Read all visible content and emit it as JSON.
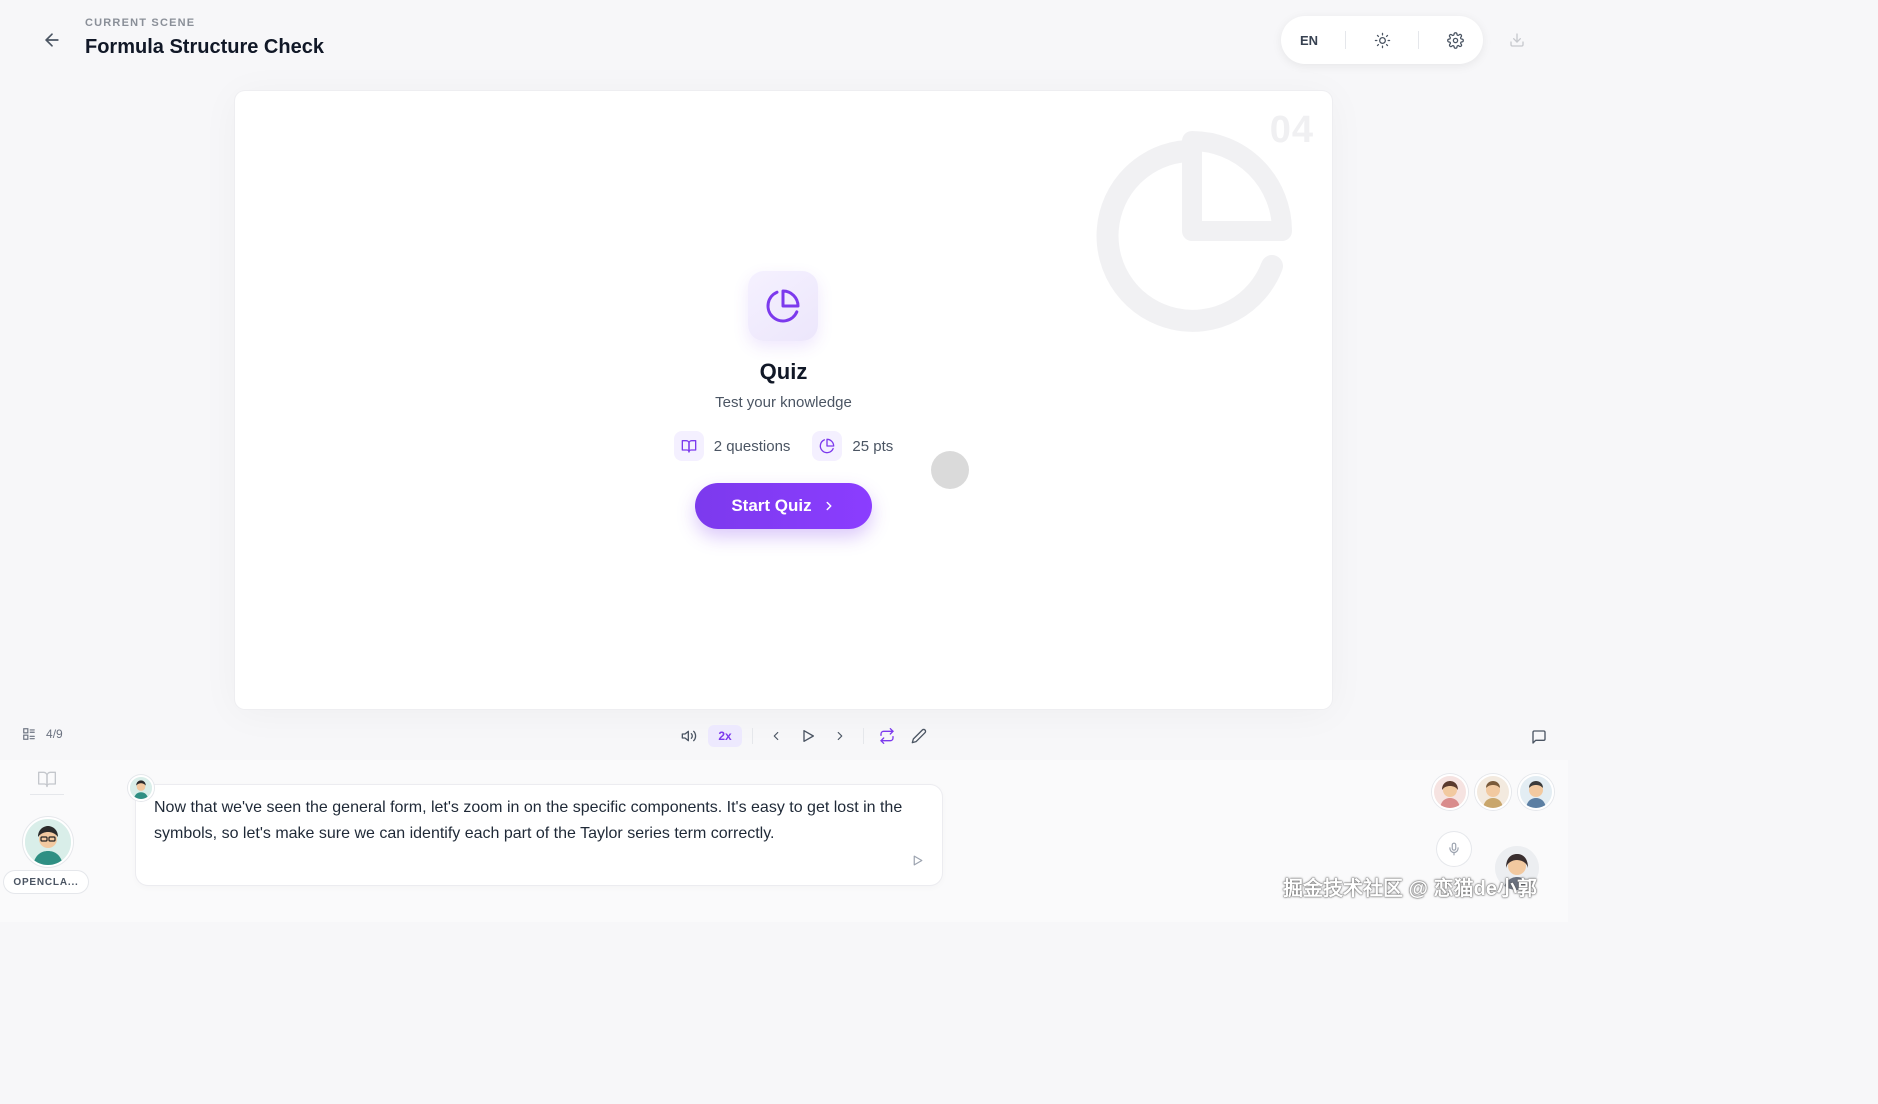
{
  "header": {
    "eyebrow": "CURRENT SCENE",
    "title": "Formula Structure Check",
    "language": "EN"
  },
  "stage": {
    "scene_number": "04",
    "quiz": {
      "title": "Quiz",
      "subtitle": "Test your knowledge",
      "questions": "2 questions",
      "points": "25 pts",
      "start_label": "Start Quiz"
    }
  },
  "playback": {
    "scene_current": "4",
    "scene_total": "9",
    "scene_sep": "/",
    "speed": "2x"
  },
  "agent": {
    "name": "OPENCLA..."
  },
  "speech": {
    "text": "Now that we've seen the general form, let's zoom in on the specific components. It's easy to get lost in the symbols, so let's make sure we can identify each part of the Taylor series term correctly."
  },
  "watermark": "掘金技术社区 @ 恋猫de小郭",
  "colors": {
    "accent": "#7c3aed",
    "accent_light": "#ede9fe",
    "background": "#f7f7f9",
    "text": "#111827"
  },
  "icons": [
    "arrow-left-icon",
    "sun-icon",
    "gear-icon",
    "download-icon",
    "pie-chart-icon",
    "book-open-icon",
    "chevron-right-icon",
    "list-icon",
    "volume-icon",
    "chevron-left-icon",
    "play-icon",
    "repeat-icon",
    "pencil-icon",
    "chat-icon",
    "mic-icon"
  ]
}
